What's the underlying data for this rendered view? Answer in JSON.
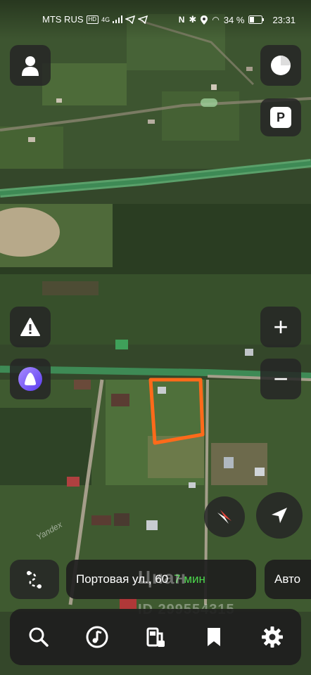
{
  "status_bar": {
    "carrier": "MTS RUS",
    "carrier_tag": "HD",
    "network": "4G",
    "battery": "34 %",
    "time": "23:31"
  },
  "map": {
    "provider_label": "Yandex",
    "plot_outline_color": "#ff6a1a",
    "road_color": "#3e8a55"
  },
  "controls": {
    "profile_icon": "user-icon",
    "layers_icon": "layers-icon",
    "parking_label": "P",
    "alert_icon": "warning-icon",
    "alice_icon": "alice-icon",
    "zoom_in_label": "+",
    "zoom_out_label": "−",
    "compass_icon": "compass-icon",
    "location_icon": "navigation-arrow-icon",
    "route_icon": "route-icon"
  },
  "route_bar": {
    "address": "Портовая ул., 60",
    "duration": "7 мин",
    "mode_label": "Авто"
  },
  "watermark": {
    "brand": "Циан",
    "listing_id": "ID 299554315"
  },
  "bottom_nav": [
    {
      "name": "search",
      "icon": "search-icon"
    },
    {
      "name": "music",
      "icon": "music-icon"
    },
    {
      "name": "fuel",
      "icon": "fuel-icon"
    },
    {
      "name": "bookmarks",
      "icon": "bookmark-icon"
    },
    {
      "name": "settings",
      "icon": "gear-icon"
    }
  ]
}
